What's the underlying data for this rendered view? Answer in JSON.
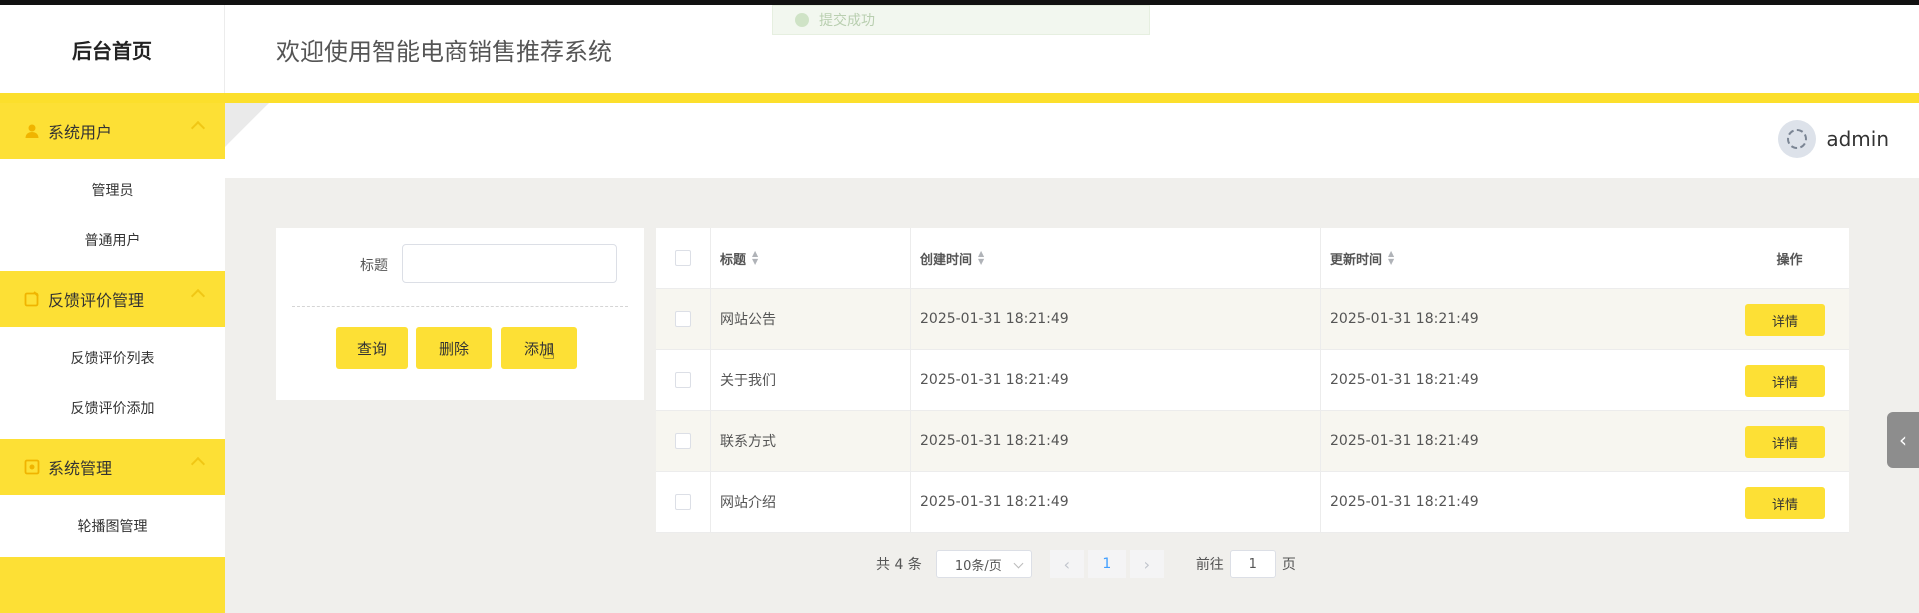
{
  "toast": {
    "text": "提交成功"
  },
  "header": {
    "brand": "后台首页",
    "welcome": "欢迎使用智能电商销售推荐系统"
  },
  "user": {
    "name": "admin"
  },
  "sidebar": {
    "groups": [
      {
        "label": "系统用户",
        "icon": "user-icon",
        "items": [
          "管理员",
          "普通用户"
        ]
      },
      {
        "label": "反馈评价管理",
        "icon": "feedback-icon",
        "items": [
          "反馈评价列表",
          "反馈评价添加"
        ]
      },
      {
        "label": "系统管理",
        "icon": "settings-icon",
        "items": [
          "轮播图管理"
        ]
      }
    ]
  },
  "search": {
    "label": "标题",
    "value": "",
    "query_btn": "查询",
    "delete_btn": "删除",
    "add_btn": "添加"
  },
  "table": {
    "columns": [
      "标题",
      "创建时间",
      "更新时间",
      "操作"
    ],
    "detail_label": "详情",
    "rows": [
      {
        "title": "网站公告",
        "created": "2025-01-31 18:21:49",
        "updated": "2025-01-31 18:21:49"
      },
      {
        "title": "关于我们",
        "created": "2025-01-31 18:21:49",
        "updated": "2025-01-31 18:21:49"
      },
      {
        "title": "联系方式",
        "created": "2025-01-31 18:21:49",
        "updated": "2025-01-31 18:21:49"
      },
      {
        "title": "网站介绍",
        "created": "2025-01-31 18:21:49",
        "updated": "2025-01-31 18:21:49"
      }
    ]
  },
  "pagination": {
    "total": "共 4 条",
    "page_size": "10条/页",
    "current": "1",
    "goto": "前往",
    "goto_value": "1",
    "page_unit": "页"
  },
  "colors": {
    "accent": "#fde035",
    "accent_line": "#fcdf2c",
    "background": "#f0efec"
  }
}
